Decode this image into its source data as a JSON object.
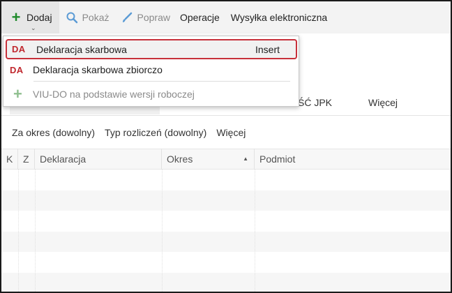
{
  "toolbar": {
    "add_label": "Dodaj",
    "show_label": "Pokaż",
    "edit_label": "Popraw",
    "operations_label": "Operacje",
    "electronic_send_label": "Wysyłka elektroniczna"
  },
  "tabs": {
    "jpk_partial": "ŚĆ JPK",
    "more": "Więcej"
  },
  "filters": {
    "period": "Za okres (dowolny)",
    "settlement_type": "Typ rozliczeń (dowolny)",
    "more": "Więcej"
  },
  "grid": {
    "columns": [
      "K",
      "Z",
      "Deklaracja",
      "Okres",
      "Podmiot"
    ]
  },
  "dropdown": {
    "items": [
      {
        "badge": "DA",
        "label": "Deklaracja skarbowa",
        "shortcut": "Insert"
      },
      {
        "badge": "DA",
        "label": "Deklaracja skarbowa zbiorczo"
      },
      {
        "label": "VIU-DO na podstawie wersji roboczej"
      }
    ]
  },
  "colors": {
    "accent_red": "#c0282e",
    "add_green": "#1f8a2b",
    "selection_border": "#c7303a"
  }
}
